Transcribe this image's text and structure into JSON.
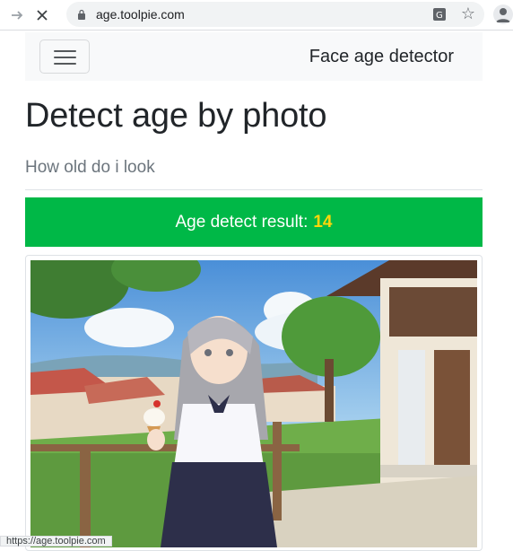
{
  "browser": {
    "url": "age.toolpie.com",
    "forward_icon": "arrow-right-icon",
    "stop_icon": "close-icon",
    "status_text": "https://age.toolpie.com"
  },
  "navbar": {
    "brand": "Face age detector",
    "toggler_icon": "hamburger-icon"
  },
  "page": {
    "title": "Detect age by photo",
    "subtitle": "How old do i look"
  },
  "result": {
    "label": "Age detect result:",
    "age": "14",
    "bg_color": "#00b847",
    "age_color": "#ffd60a"
  },
  "photo": {
    "alt": "anime girl holding ice cream"
  }
}
